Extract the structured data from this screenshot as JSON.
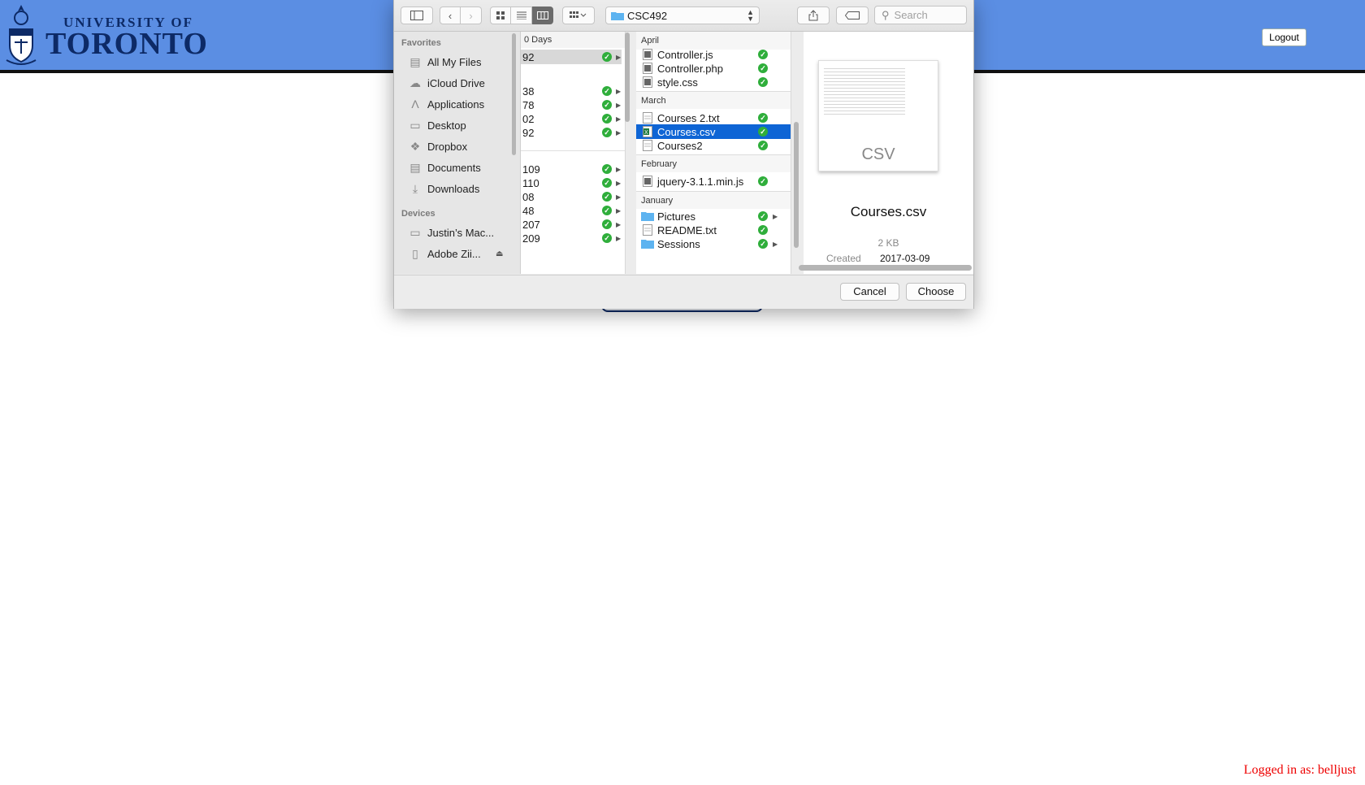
{
  "header": {
    "logo_top": "UNIVERSITY OF",
    "logo_main": "TORONTO",
    "logout_label": "Logout"
  },
  "status": {
    "logged_in_text": "Logged in as: belljust"
  },
  "dialog": {
    "toolbar": {
      "path_label": "CSC492",
      "search_placeholder": "Search"
    },
    "sidebar": {
      "favorites_heading": "Favorites",
      "favorites": [
        {
          "label": "All My Files",
          "icon": "all-files-icon"
        },
        {
          "label": "iCloud Drive",
          "icon": "cloud-icon"
        },
        {
          "label": "Applications",
          "icon": "applications-icon"
        },
        {
          "label": "Desktop",
          "icon": "desktop-icon"
        },
        {
          "label": "Dropbox",
          "icon": "dropbox-icon"
        },
        {
          "label": "Documents",
          "icon": "documents-icon"
        },
        {
          "label": "Downloads",
          "icon": "downloads-icon"
        }
      ],
      "devices_heading": "Devices",
      "devices": [
        {
          "label": "Justin’s Mac...",
          "icon": "laptop-icon"
        },
        {
          "label": "Adobe Zii...",
          "icon": "disk-icon"
        }
      ]
    },
    "column1": {
      "header": "0 Days",
      "rows": [
        "92",
        "38",
        "78",
        "02",
        "92",
        "109",
        "110",
        "08",
        "48",
        "207",
        "209"
      ]
    },
    "column2": {
      "groups": {
        "april": "April",
        "march": "March",
        "february": "February",
        "january": "January"
      },
      "april_files": [
        "Controller.js",
        "Controller.php",
        "style.css"
      ],
      "march_files": [
        "Courses 2.txt",
        "Courses.csv",
        "Courses2"
      ],
      "february_files": [
        "jquery-3.1.1.min.js"
      ],
      "january_files": [
        "Pictures",
        "README.txt",
        "Sessions"
      ]
    },
    "preview": {
      "file_type_label": "CSV",
      "file_name": "Courses.csv",
      "file_size": "2 KB",
      "created_label": "Created",
      "created_value": "2017-03-09"
    },
    "footer": {
      "cancel_label": "Cancel",
      "choose_label": "Choose"
    }
  },
  "colors": {
    "header_bg": "#5b8ee3",
    "selection": "#0e65d5",
    "status_red": "#e00000",
    "check_green": "#2fae3b"
  }
}
